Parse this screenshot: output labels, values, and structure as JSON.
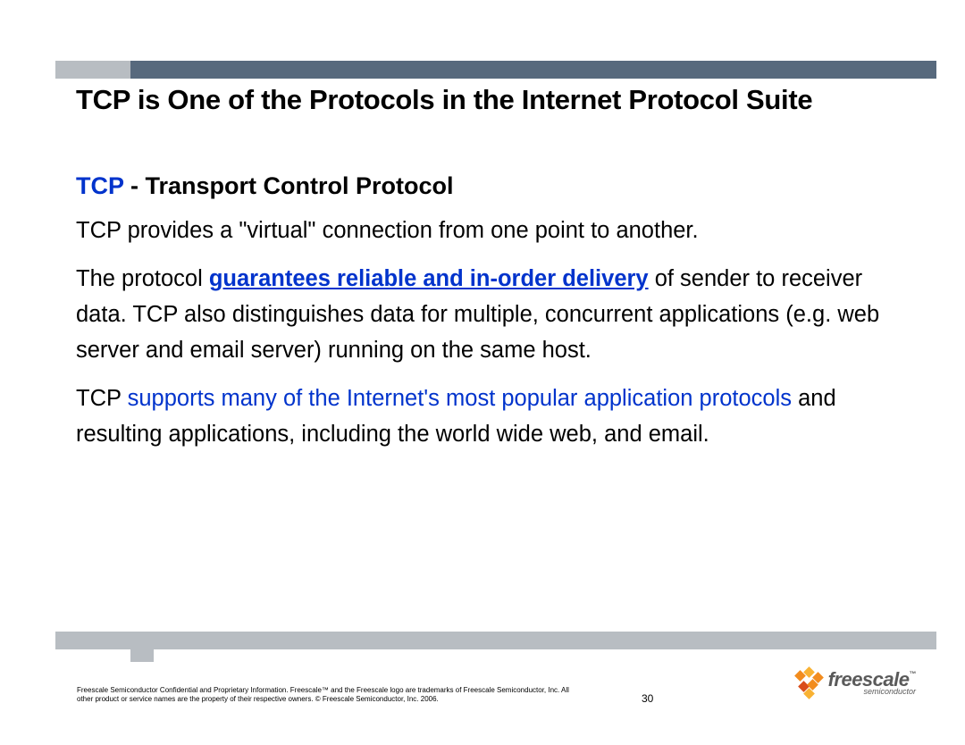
{
  "title": "TCP is One of the Protocols in the Internet Protocol Suite",
  "subtitle": {
    "accent": "TCP ",
    "rest": "- Transport Control Protocol"
  },
  "body": {
    "p1": "TCP provides a \"virtual\" connection from one point to another.",
    "p2a": "The protocol ",
    "p2link": "guarantees reliable and in-order delivery",
    "p2b": " of sender to receiver data. TCP also distinguishes data for multiple, concurrent applications (e.g. web server and email server) running on the same host.",
    "p3a": "TCP ",
    "p3blue": "supports many of the Internet's most popular application protocols",
    "p3b": " and resulting applications, including the world wide web, and email."
  },
  "footer": {
    "legal": "Freescale Semiconductor Confidential and Proprietary Information. Freescale™ and the Freescale logo are trademarks of Freescale Semiconductor, Inc. All other product or service names are the property of their respective owners. © Freescale Semiconductor, Inc. 2006.",
    "page": "30",
    "logo_main": "freescale",
    "logo_tm": "™",
    "logo_sub": "semiconductor"
  }
}
